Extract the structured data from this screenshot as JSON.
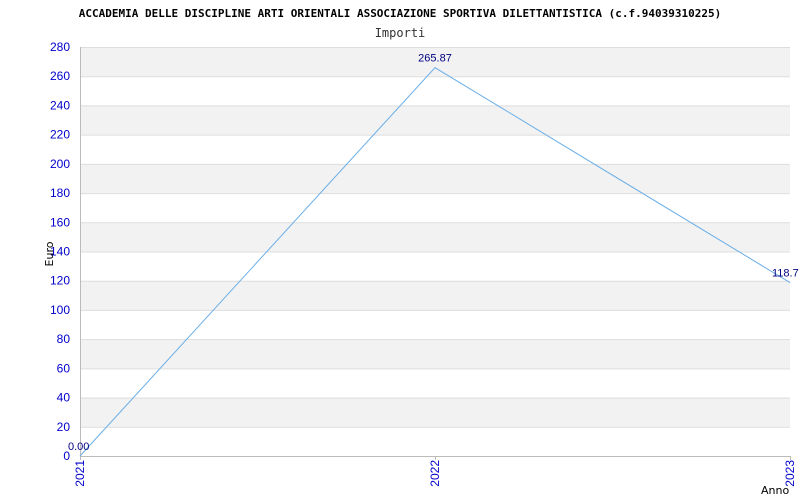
{
  "chart_data": {
    "type": "line",
    "title": "ACCADEMIA DELLE DISCIPLINE ARTI ORIENTALI ASSOCIAZIONE SPORTIVA DILETTANTISTICA (c.f.94039310225)",
    "subtitle": "Importi",
    "xlabel": "Anno",
    "ylabel": "Euro",
    "categories": [
      "2021",
      "2022",
      "2023"
    ],
    "series": [
      {
        "values": [
          0,
          265.87,
          118.7
        ],
        "labels": [
          "0.00",
          "265.87",
          "118.7"
        ]
      }
    ],
    "ylim": [
      0,
      280
    ],
    "yticks": [
      0,
      20,
      40,
      60,
      80,
      100,
      120,
      140,
      160,
      180,
      200,
      220,
      240,
      260,
      280
    ],
    "grid": true,
    "colors": {
      "line": "#6aaee8",
      "band": "#f2f2f2",
      "tick_text": "#0000cc",
      "label_text": "#000080"
    }
  }
}
